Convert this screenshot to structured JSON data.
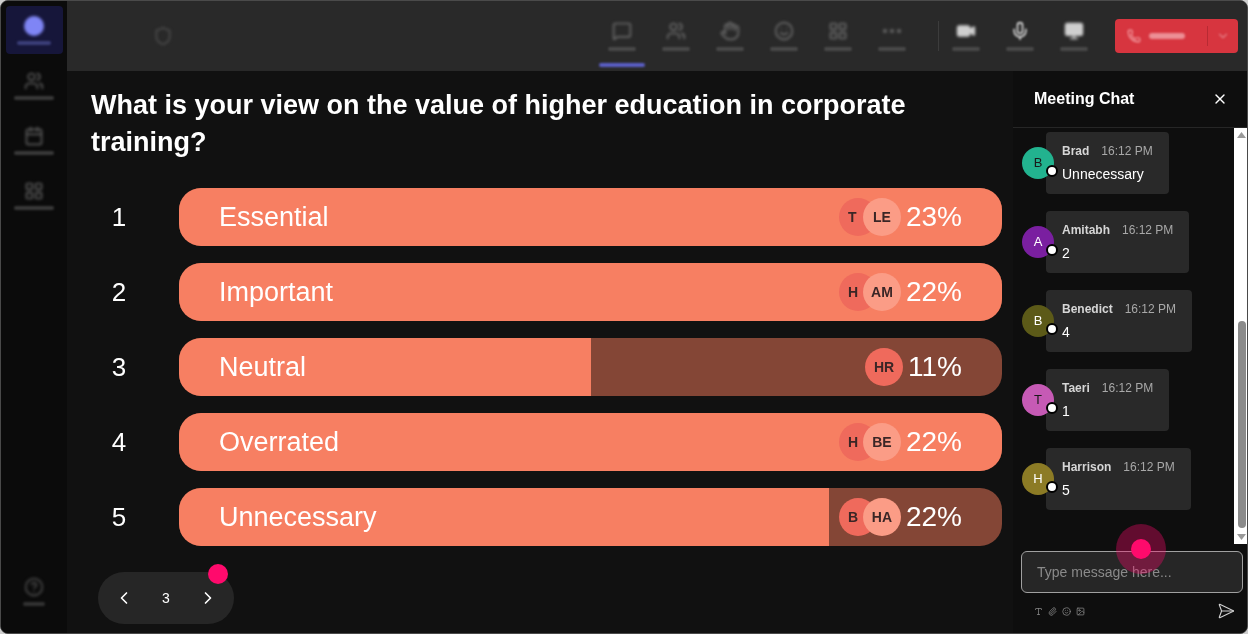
{
  "sidebar": {
    "items": [
      {
        "selected": true
      },
      {
        "selected": false
      },
      {
        "selected": false
      },
      {
        "selected": false
      }
    ]
  },
  "toolbar": {
    "items": [
      {
        "selected": true
      },
      {
        "selected": false
      },
      {
        "selected": false
      },
      {
        "selected": false
      },
      {
        "selected": false
      },
      {
        "selected": false
      }
    ]
  },
  "poll": {
    "question": "What is your view on the value of higher education in corporate training?",
    "options": [
      {
        "number": "1",
        "label": "Essential",
        "level": 1,
        "voters": [
          "T",
          "LE"
        ],
        "percent": "23%"
      },
      {
        "number": "2",
        "label": "Important",
        "level": 1,
        "voters": [
          "H",
          "AM"
        ],
        "percent": "22%"
      },
      {
        "number": "3",
        "label": "Neutral",
        "level": 0.5,
        "voters": [
          "HR"
        ],
        "percent": "11%"
      },
      {
        "number": "4",
        "label": "Overrated",
        "level": 1,
        "voters": [
          "H",
          "BE"
        ],
        "percent": "22%"
      },
      {
        "number": "5",
        "label": "Unnecessary",
        "level": 0.79,
        "voters": [
          "B",
          "HA"
        ],
        "percent": "22%"
      }
    ],
    "pager": {
      "page": "3"
    }
  },
  "chat": {
    "title": "Meeting Chat",
    "messages": [
      {
        "initial": "B",
        "color": "#22b38f",
        "name": "Brad",
        "time": "16:12 PM",
        "text": "Unnecessary"
      },
      {
        "initial": "A",
        "color": "#7a1fa0",
        "name": "Amitabh",
        "time": "16:12 PM",
        "text": "2"
      },
      {
        "initial": "B",
        "color": "#5c5a18",
        "name": "Benedict",
        "time": "16:12 PM",
        "text": "4"
      },
      {
        "initial": "T",
        "color": "#c65ab5",
        "name": "Taeri",
        "time": "16:12 PM",
        "text": "1"
      },
      {
        "initial": "H",
        "color": "#8c7b25",
        "name": "Harrison",
        "time": "16:12 PM",
        "text": "5"
      }
    ],
    "input": {
      "placeholder": "Type message here..."
    }
  }
}
